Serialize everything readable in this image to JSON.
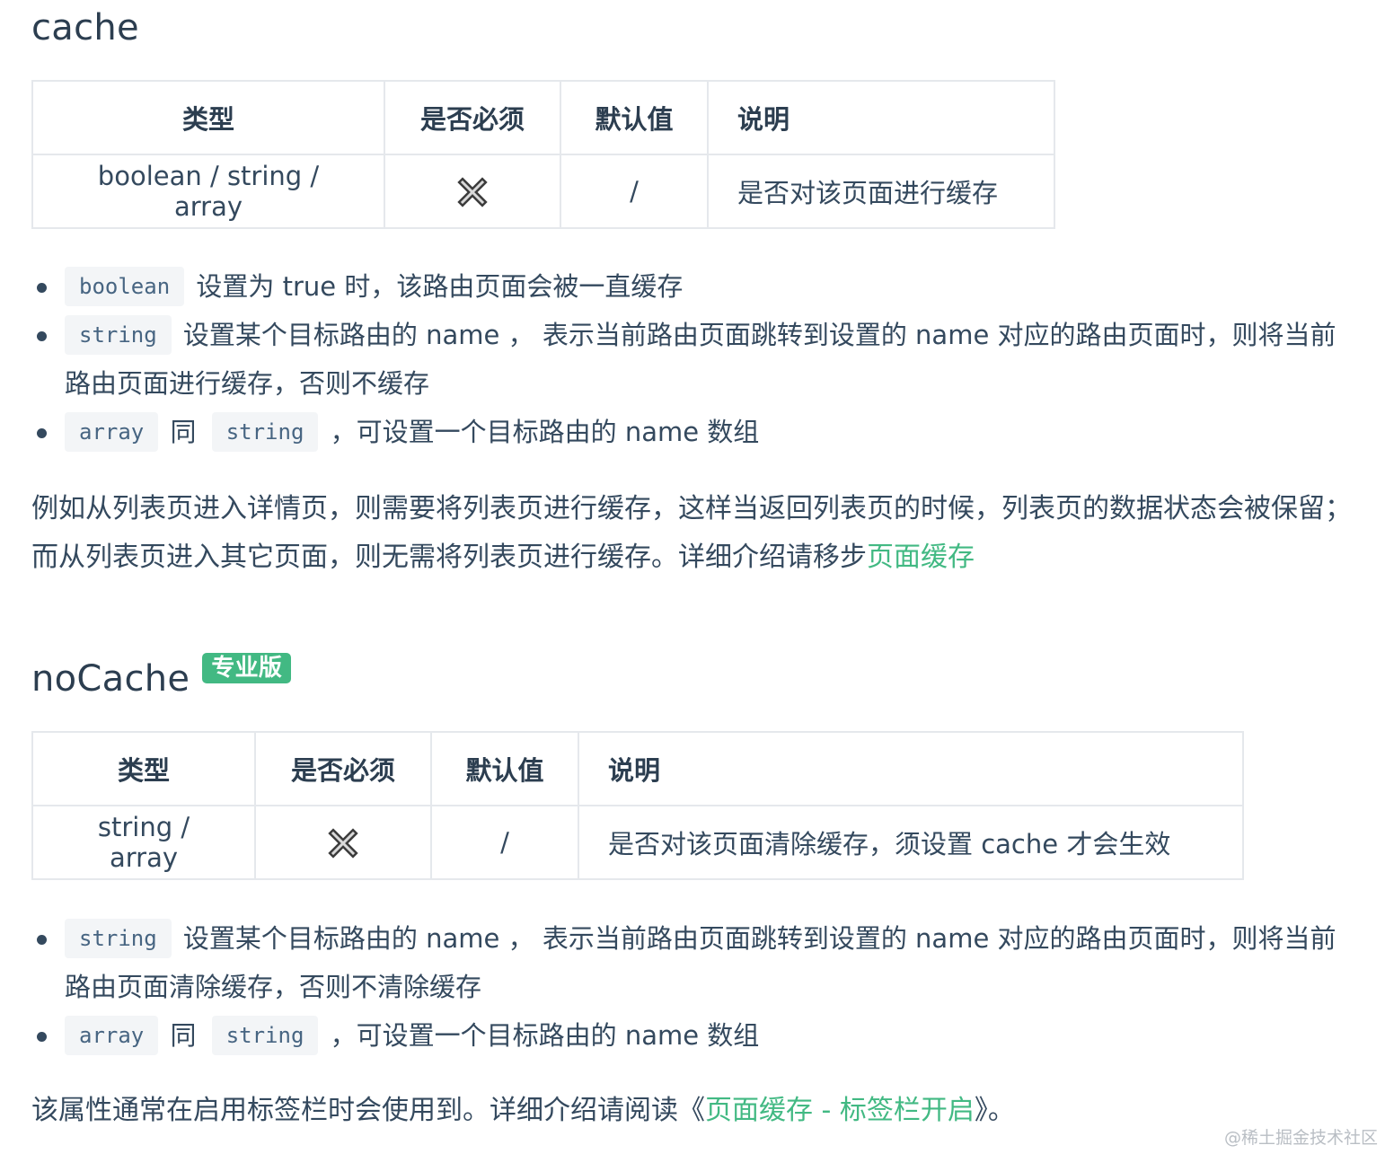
{
  "cache": {
    "title": "cache",
    "table": {
      "headers": [
        "类型",
        "是否必须",
        "默认值",
        "说明"
      ],
      "row": {
        "type": "boolean / string / array",
        "required_icon": "cross-icon",
        "default": "/",
        "desc": "是否对该页面进行缓存"
      }
    },
    "bullets": [
      {
        "code": "boolean",
        "text": "设置为 true 时，该路由页面会被一直缓存"
      },
      {
        "code": "string",
        "text": "设置某个目标路由的 name ， 表示当前路由页面跳转到设置的 name 对应的路由页面时，则将当前路由页面进行缓存，否则不缓存"
      },
      {
        "code": "array",
        "mid": "同",
        "code2": "string",
        "text": "，可设置一个目标路由的 name 数组"
      }
    ],
    "paragraph": "例如从列表页进入详情页，则需要将列表页进行缓存，这样当返回列表页的时候，列表页的数据状态会被保留；而从列表页进入其它页面，则无需将列表页进行缓存。详细介绍请移步",
    "link": "页面缓存"
  },
  "nocache": {
    "title": "noCache",
    "badge": "专业版",
    "table": {
      "headers": [
        "类型",
        "是否必须",
        "默认值",
        "说明"
      ],
      "row": {
        "type": "string / array",
        "required_icon": "cross-icon",
        "default": "/",
        "desc": "是否对该页面清除缓存，须设置 cache 才会生效"
      }
    },
    "bullets": [
      {
        "code": "string",
        "text": "设置某个目标路由的 name ， 表示当前路由页面跳转到设置的 name 对应的路由页面时，则将当前路由页面清除缓存，否则不清除缓存"
      },
      {
        "code": "array",
        "mid": "同",
        "code2": "string",
        "text": "，可设置一个目标路由的 name 数组"
      }
    ],
    "paragraph_before": "该属性通常在启用标签栏时会使用到。详细介绍请阅读《",
    "link": "页面缓存 - 标签栏开启",
    "paragraph_after": "》。"
  },
  "watermark": "@稀土掘金技术社区",
  "colors": {
    "link": "#42b983",
    "badge": "#42b983",
    "text": "#34495e",
    "code_bg": "#f3f5f7",
    "code_text": "#476582"
  }
}
